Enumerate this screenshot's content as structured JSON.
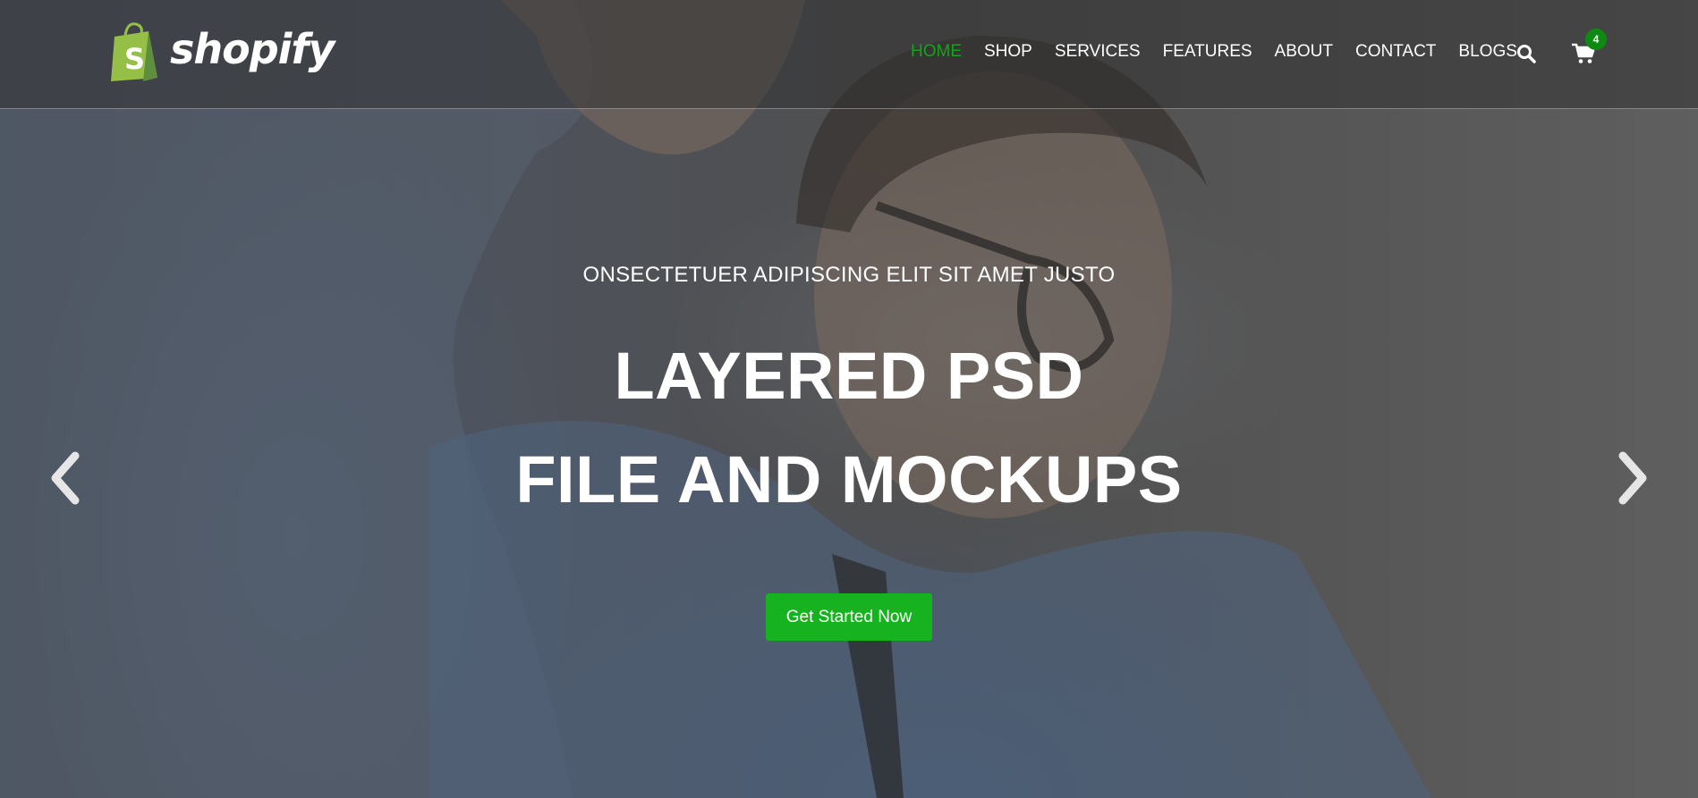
{
  "brand": {
    "name": "shopify",
    "logo_color": "#95bf47"
  },
  "nav": {
    "items": [
      {
        "label": "HOME",
        "active": true
      },
      {
        "label": "SHOP"
      },
      {
        "label": "SERVICES"
      },
      {
        "label": "FEATURES"
      },
      {
        "label": "ABOUT"
      },
      {
        "label": "CONTACT"
      },
      {
        "label": "BLOGS"
      }
    ],
    "search_icon": "search-icon",
    "cart_icon": "cart-icon",
    "cart_count": "4"
  },
  "hero": {
    "subtitle": "ONSECTETUER ADIPISCING ELIT SIT AMET JUSTO",
    "headline_line1": "LAYERED PSD",
    "headline_line2": "FILE AND MOCKUPS",
    "cta_label": "Get Started Now",
    "prev_icon": "chevron-left-icon",
    "next_icon": "chevron-right-icon"
  },
  "colors": {
    "accent": "#16b21f",
    "active_nav": "#15a21c",
    "badge": "#0d8a12"
  }
}
